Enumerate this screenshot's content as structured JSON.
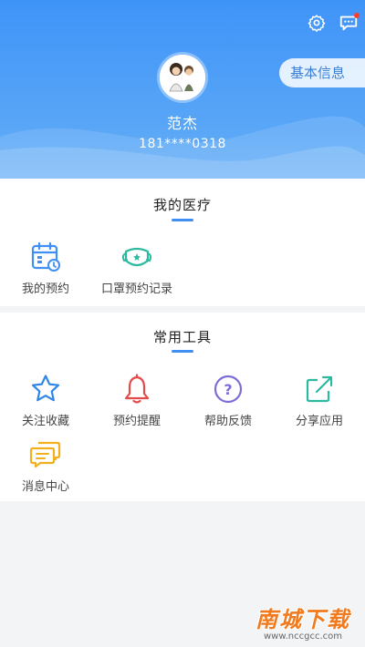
{
  "header": {
    "user_name": "范杰",
    "phone": "181****0318",
    "basic_info_label": "基本信息"
  },
  "medical": {
    "title": "我的医疗",
    "items": [
      {
        "label": "我的预约",
        "icon": "calendar-icon"
      },
      {
        "label": "口罩预约记录",
        "icon": "mask-icon"
      }
    ]
  },
  "tools": {
    "title": "常用工具",
    "items": [
      {
        "label": "关注收藏",
        "icon": "star-icon"
      },
      {
        "label": "预约提醒",
        "icon": "bell-icon"
      },
      {
        "label": "帮助反馈",
        "icon": "help-icon"
      },
      {
        "label": "分享应用",
        "icon": "share-icon"
      },
      {
        "label": "消息中心",
        "icon": "chat-icon"
      }
    ]
  },
  "watermark": {
    "main": "南城下载",
    "sub": "www.nccgcc.com"
  },
  "colors": {
    "header_blue": "#3f94f8",
    "accent_blue": "#3f8ff4",
    "star_blue": "#2f86e6",
    "bell_red": "#e34b4b",
    "help_purple": "#7b6fd6",
    "share_teal": "#2cb9a0",
    "chat_orange": "#f2b01e"
  }
}
